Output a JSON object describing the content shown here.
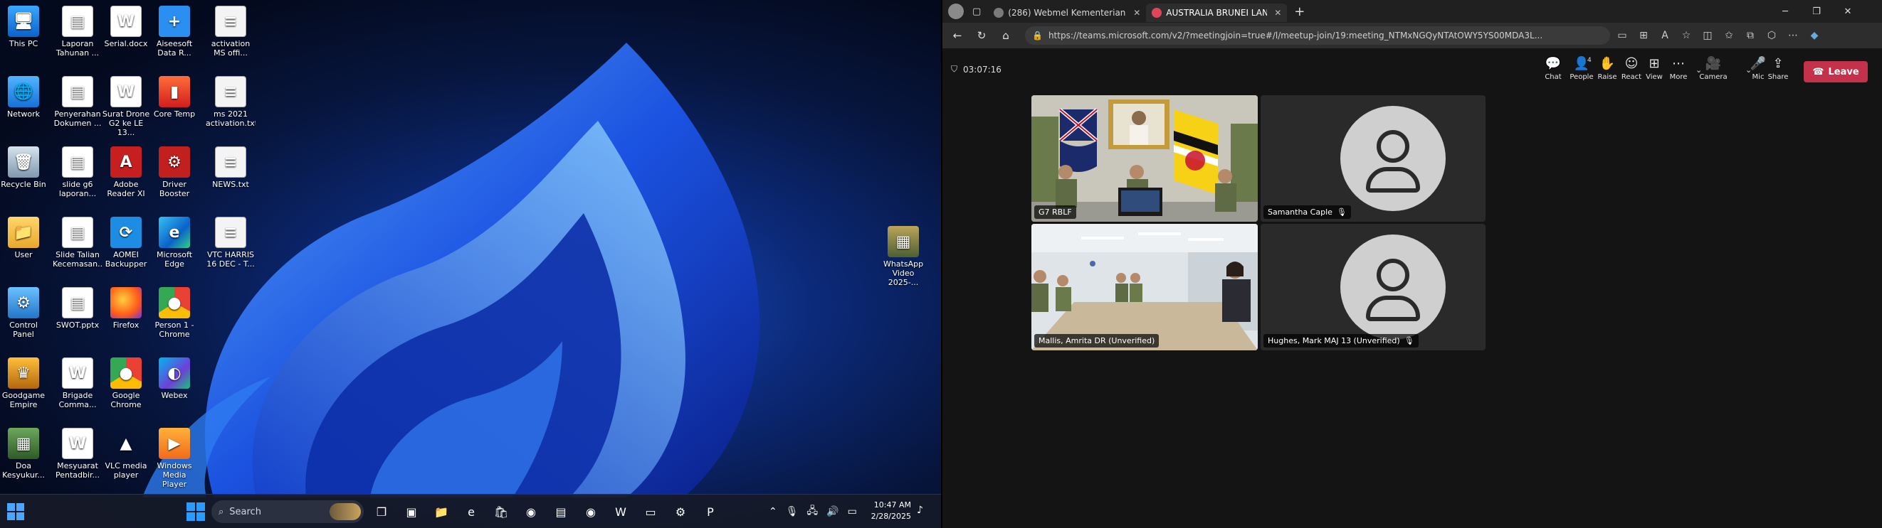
{
  "desktop": {
    "icons": [
      {
        "id": "this-pc",
        "label": "This PC",
        "glyph": "🖥",
        "cls": "g-pc",
        "col": 0,
        "row": 0
      },
      {
        "id": "network",
        "label": "Network",
        "glyph": "🌐",
        "cls": "g-net",
        "col": 0,
        "row": 1
      },
      {
        "id": "recycle-bin",
        "label": "Recycle Bin",
        "glyph": "🗑",
        "cls": "g-bin",
        "col": 0,
        "row": 2
      },
      {
        "id": "user",
        "label": "User",
        "glyph": "📁",
        "cls": "g-folder",
        "col": 0,
        "row": 3
      },
      {
        "id": "control-panel",
        "label": "Control Panel",
        "glyph": "⚙",
        "cls": "g-cp",
        "col": 0,
        "row": 4
      },
      {
        "id": "goodgame-empire",
        "label": "Goodgame Empire",
        "glyph": "♛",
        "cls": "g-game",
        "col": 0,
        "row": 5
      },
      {
        "id": "doa-kesyukuran",
        "label": "Doa Kesyukur...",
        "glyph": "▦",
        "cls": "g-doa",
        "col": 0,
        "row": 6
      },
      {
        "id": "laporan-tahunan",
        "label": "Laporan Tahunan ...",
        "glyph": "▤",
        "cls": "g-doc",
        "col": 1,
        "row": 0
      },
      {
        "id": "penyerahan-dokumen",
        "label": "Penyerahan Dokumen ...",
        "glyph": "▤",
        "cls": "g-doc",
        "col": 1,
        "row": 1
      },
      {
        "id": "slide-g6",
        "label": "slide g6 laporan...",
        "glyph": "▤",
        "cls": "g-doc",
        "col": 1,
        "row": 2
      },
      {
        "id": "slide-talian",
        "label": "Slide Talian Kecemasan...",
        "glyph": "▤",
        "cls": "g-doc",
        "col": 1,
        "row": 3
      },
      {
        "id": "swot-pptx",
        "label": "SWOT.pptx",
        "glyph": "▤",
        "cls": "g-doc",
        "col": 1,
        "row": 4
      },
      {
        "id": "brigade-comma",
        "label": "Brigade Comma...",
        "glyph": "W",
        "cls": "g-word",
        "col": 1,
        "row": 5
      },
      {
        "id": "mesyuarat",
        "label": "Mesyuarat Pentadbir...",
        "glyph": "W",
        "cls": "g-word",
        "col": 1,
        "row": 6
      },
      {
        "id": "serial-docx",
        "label": "Serial.docx",
        "glyph": "W",
        "cls": "g-word",
        "col": 2,
        "row": 0
      },
      {
        "id": "surat-drone",
        "label": "Surat Drone G2 ke LE 13...",
        "glyph": "W",
        "cls": "g-word",
        "col": 2,
        "row": 1
      },
      {
        "id": "adobe-reader",
        "label": "Adobe Reader XI",
        "glyph": "A",
        "cls": "g-pdf",
        "col": 2,
        "row": 2
      },
      {
        "id": "aomei-backupper",
        "label": "AOMEI Backupper",
        "glyph": "⟳",
        "cls": "g-aomei",
        "col": 2,
        "row": 3
      },
      {
        "id": "firefox",
        "label": "Firefox",
        "glyph": "",
        "cls": "g-ff",
        "col": 2,
        "row": 4
      },
      {
        "id": "google-chrome",
        "label": "Google Chrome",
        "glyph": "●",
        "cls": "g-chrome",
        "col": 2,
        "row": 5
      },
      {
        "id": "vlc",
        "label": "VLC media player",
        "glyph": "▲",
        "cls": "g-vlc",
        "col": 2,
        "row": 6
      },
      {
        "id": "aiseesoft",
        "label": "Aiseesoft Data R...",
        "glyph": "+",
        "cls": "g-aise",
        "col": 3,
        "row": 0
      },
      {
        "id": "core-temp",
        "label": "Core Temp",
        "glyph": "▮",
        "cls": "g-core",
        "col": 3,
        "row": 1
      },
      {
        "id": "driver-booster",
        "label": "Driver Booster",
        "glyph": "⚙",
        "cls": "g-drv",
        "col": 3,
        "row": 2
      },
      {
        "id": "microsoft-edge",
        "label": "Microsoft Edge",
        "glyph": "e",
        "cls": "g-edge",
        "col": 3,
        "row": 3
      },
      {
        "id": "person1-chrome",
        "label": "Person 1 - Chrome",
        "glyph": "●",
        "cls": "g-chrome",
        "col": 3,
        "row": 4
      },
      {
        "id": "webex",
        "label": "Webex",
        "glyph": "◐",
        "cls": "g-webex",
        "col": 3,
        "row": 5
      },
      {
        "id": "windows-media-player",
        "label": "Windows Media Player",
        "glyph": "▶",
        "cls": "g-wmp",
        "col": 3,
        "row": 6
      },
      {
        "id": "activation-ms",
        "label": "activation MS offi...",
        "glyph": "≡",
        "cls": "g-txt",
        "col": 4,
        "row": 0
      },
      {
        "id": "ms2021-activation",
        "label": "ms 2021 activation.txt",
        "glyph": "≡",
        "cls": "g-txt",
        "col": 4,
        "row": 1
      },
      {
        "id": "news-txt",
        "label": "NEWS.txt",
        "glyph": "≡",
        "cls": "g-txt",
        "col": 4,
        "row": 2
      },
      {
        "id": "vtc-harris",
        "label": "VTC HARRIS 16 DEC - T...",
        "glyph": "≡",
        "cls": "g-txt",
        "col": 4,
        "row": 3
      },
      {
        "id": "whatsapp-video",
        "label": "WhatsApp Video 2025-...",
        "glyph": "▦",
        "cls": "g-media",
        "col": "wa",
        "row": 0
      }
    ]
  },
  "taskbar": {
    "search_label": "Search",
    "time": "10:47 AM",
    "date": "2/28/2025",
    "apps": [
      {
        "name": "task-view-icon",
        "glyph": "❐"
      },
      {
        "name": "teams-icon",
        "glyph": "▣"
      },
      {
        "name": "file-explorer-icon",
        "glyph": "📁"
      },
      {
        "name": "edge-icon",
        "glyph": "e"
      },
      {
        "name": "store-icon",
        "glyph": "🛍"
      },
      {
        "name": "firefox-icon",
        "glyph": "◉"
      },
      {
        "name": "app-icon",
        "glyph": "▤"
      },
      {
        "name": "chrome-icon",
        "glyph": "◉"
      },
      {
        "name": "word-icon",
        "glyph": "W"
      },
      {
        "name": "terminal-icon",
        "glyph": "▭"
      },
      {
        "name": "settings-icon",
        "glyph": "⚙"
      },
      {
        "name": "powerpoint-icon",
        "glyph": "P"
      }
    ]
  },
  "browser": {
    "tabs": [
      {
        "title": "(286) Webmel Kementerian Pertah...",
        "active": false,
        "color": "#7a7a7a"
      },
      {
        "title": "AUSTRALIA BRUNEI LAND W...",
        "active": true,
        "color": "#e0455a"
      }
    ],
    "url": "https://teams.microsoft.com/v2/?meetingjoin=true#/l/meetup-join/19:meeting_NTMxNGQyNTAtOWY5YS00MDA3L..."
  },
  "meeting": {
    "elapsed": "03:07:16",
    "controls": [
      {
        "id": "chat",
        "label": "Chat",
        "glyph": "💬"
      },
      {
        "id": "people",
        "label": "People",
        "glyph": "👤",
        "badge": "4"
      },
      {
        "id": "raise",
        "label": "Raise",
        "glyph": "✋"
      },
      {
        "id": "react",
        "label": "React",
        "glyph": "☺"
      },
      {
        "id": "view",
        "label": "View",
        "glyph": "⊞"
      },
      {
        "id": "more",
        "label": "More",
        "glyph": "⋯"
      },
      {
        "id": "camera",
        "label": "Camera",
        "glyph": "🎥"
      },
      {
        "id": "mic",
        "label": "Mic",
        "glyph": "🎤"
      },
      {
        "id": "share",
        "label": "Share",
        "glyph": "⇪"
      }
    ],
    "leave_label": "Leave",
    "participants": [
      {
        "name": "G7 RBLF",
        "muted": false
      },
      {
        "name": "Samantha Caple",
        "muted": true
      },
      {
        "name": "Mallis, Amrita DR (Unverified)",
        "muted": false
      },
      {
        "name": "Hughes, Mark MAJ 13 (Unverified)",
        "muted": true
      }
    ]
  }
}
